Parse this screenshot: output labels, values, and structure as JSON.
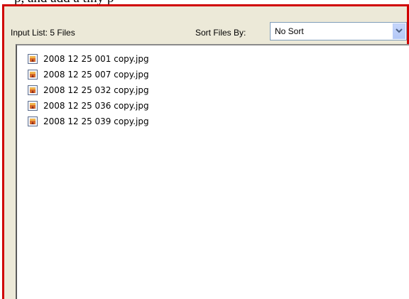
{
  "top_caption": "p, and add a tiny p",
  "panel": {
    "list_label": "Input List:  5 Files",
    "sort_label": "Sort Files By:",
    "sort_selected": "No Sort"
  },
  "files": [
    "2008 12 25 001 copy.jpg",
    "2008 12 25 007 copy.jpg",
    "2008 12 25 032 copy.jpg",
    "2008 12 25 036 copy.jpg",
    "2008 12 25 039 copy.jpg"
  ],
  "colors": {
    "frame_border": "#d00000",
    "panel_background": "#ece9d8",
    "field_border": "#7f9db9",
    "dropdown_arrow": "#4d6185"
  },
  "icons": {
    "file": "jpg-file-icon",
    "dropdown": "chevron-down-icon"
  }
}
